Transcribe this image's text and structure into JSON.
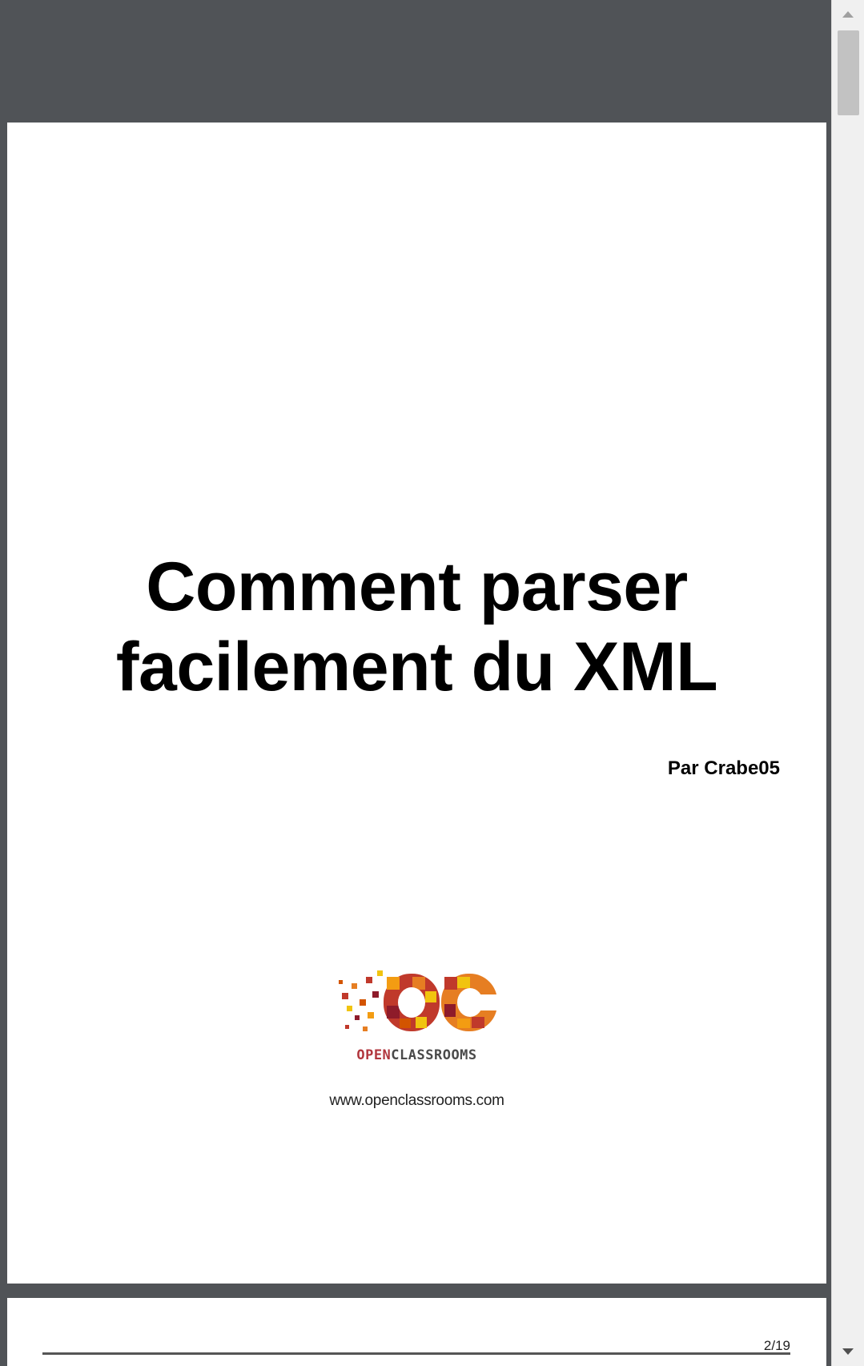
{
  "document": {
    "title": "Comment parser facilement du XML",
    "author": "Par Crabe05",
    "url": "www.openclassrooms.com",
    "page_indicator": "2/19"
  },
  "logo": {
    "monogram": "OC",
    "wordmark_open": "OPEN",
    "wordmark_classrooms": "CLASSROOMS",
    "colors": [
      "#c0392b",
      "#e67e22",
      "#f1c40f",
      "#8e1b2a",
      "#d35400",
      "#f39c12"
    ]
  },
  "scrollbar": {
    "up_icon": "triangle-up-icon",
    "down_icon": "triangle-down-icon"
  }
}
